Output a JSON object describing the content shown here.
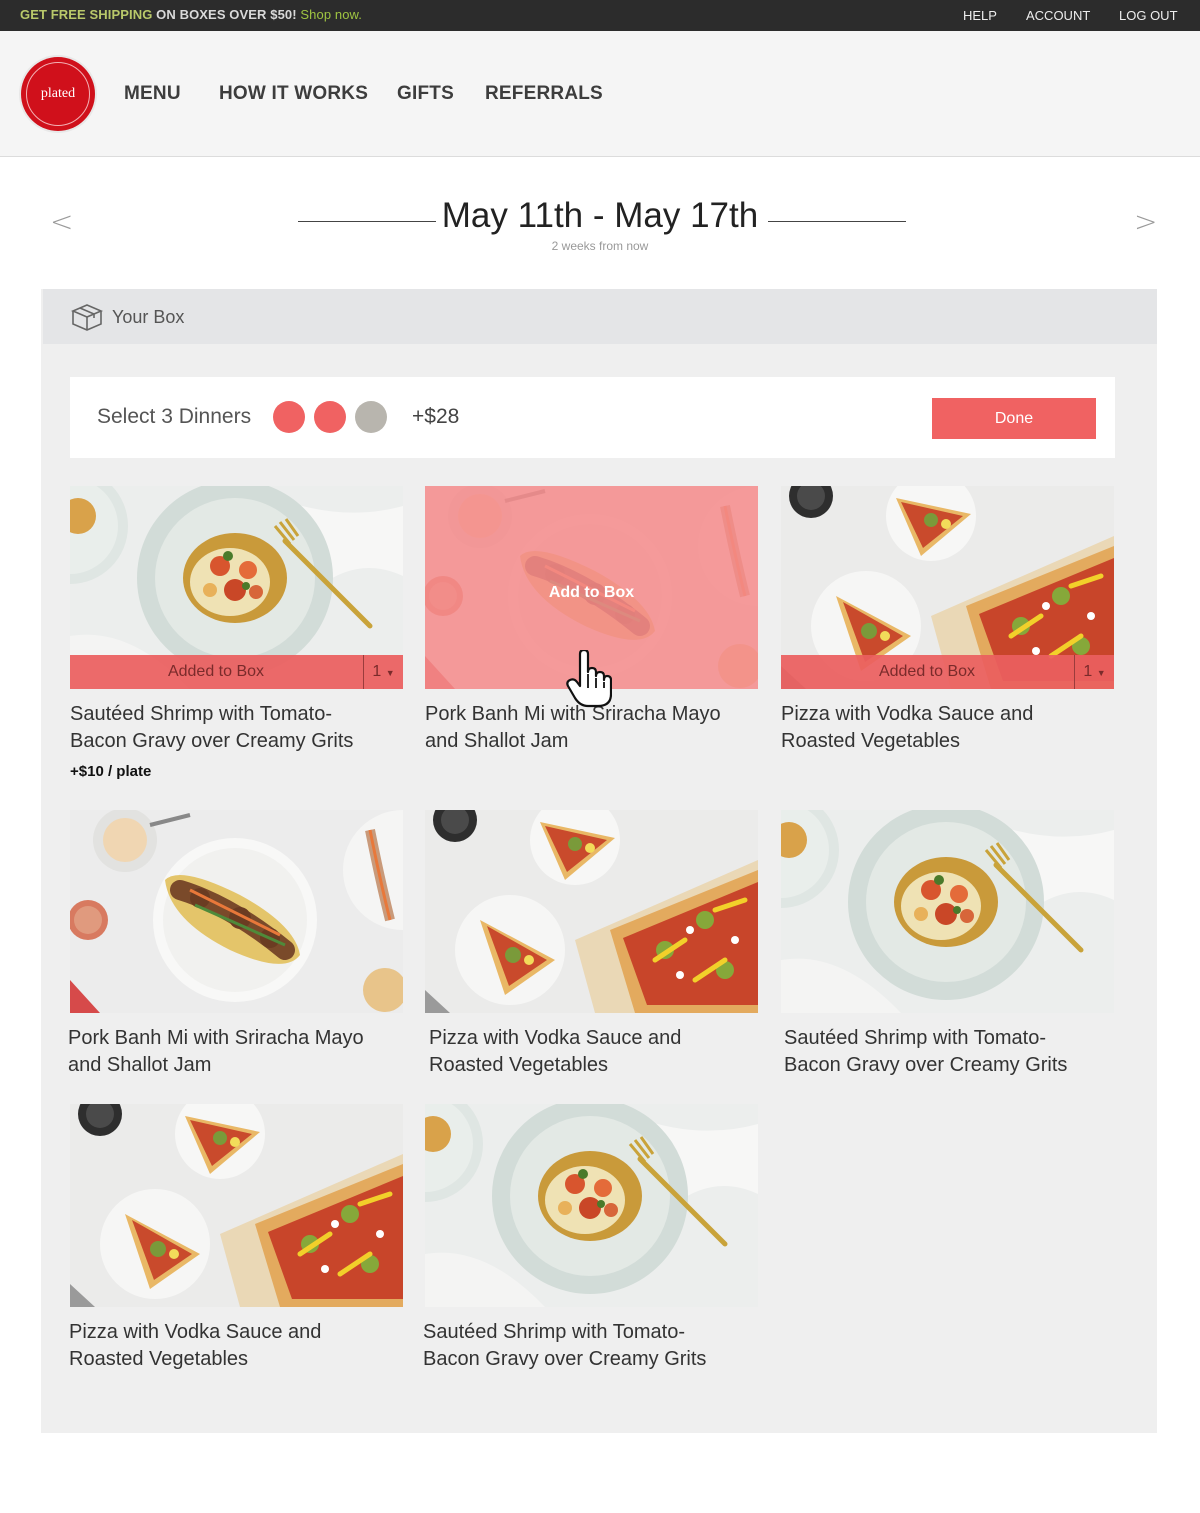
{
  "promo": {
    "bold1": "GET FREE SHIPPING",
    "text": " ON BOXES OVER $50! ",
    "link": "Shop now."
  },
  "top_links": [
    "HELP",
    "ACCOUNT",
    "LOG OUT"
  ],
  "logo_text": "plated",
  "nav": [
    "MENU",
    "HOW IT WORKS",
    "GIFTS",
    "REFERRALS"
  ],
  "week": {
    "title": "May 11th - May 17th",
    "subtitle": "2 weeks from now",
    "prev_icon": "chevron-left-icon",
    "next_icon": "chevron-right-icon"
  },
  "box": {
    "label": "Your Box",
    "icon": "box-icon"
  },
  "selection": {
    "text": "Select 3 Dinners",
    "slots": [
      {
        "filled": true,
        "color": "#f06262"
      },
      {
        "filled": true,
        "color": "#f06262"
      },
      {
        "filled": false,
        "color": "#b8b5ae"
      }
    ],
    "price": "+$28",
    "done_label": "Done"
  },
  "colors": {
    "accent": "#f06262",
    "dark_bar": "#2c2c2c",
    "promo_link": "#9fc441"
  },
  "cards": [
    {
      "title_line1": "Sautéed Shrimp with Tomato-",
      "title_line2": "Bacon Gravy over Creamy Grits",
      "price": "+$10 / plate",
      "state": "added",
      "added_label": "Added to Box",
      "qty": "1"
    },
    {
      "title_line1": "Pork Banh Mi with Sriracha Mayo",
      "title_line2": "and Shallot Jam",
      "state": "hover",
      "hover_label": "Add to Box"
    },
    {
      "title_line1": "Pizza with Vodka Sauce and",
      "title_line2": "Roasted Vegetables",
      "state": "added",
      "added_label": "Added to Box",
      "qty": "1"
    },
    {
      "title_line1": "Pork Banh Mi with Sriracha Mayo",
      "title_line2": "and Shallot Jam"
    },
    {
      "title_line1": "Pizza with Vodka Sauce and",
      "title_line2": "Roasted Vegetables"
    },
    {
      "title_line1": "Sautéed Shrimp with Tomato-",
      "title_line2": "Bacon Gravy over Creamy Grits"
    },
    {
      "title_line1": "Pizza with Vodka Sauce and",
      "title_line2": "Roasted Vegetables"
    },
    {
      "title_line1": "Sautéed Shrimp with Tomato-",
      "title_line2": "Bacon Gravy over Creamy Grits"
    }
  ]
}
